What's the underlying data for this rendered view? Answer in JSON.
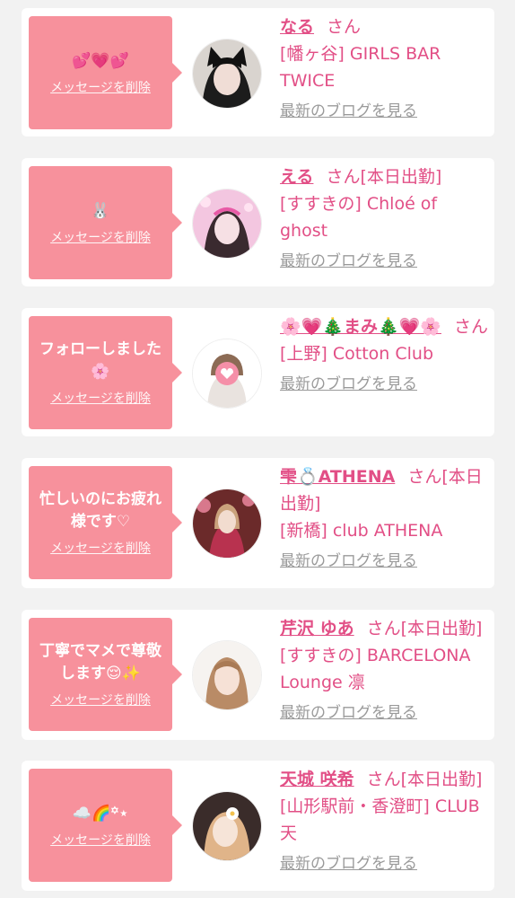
{
  "messages": [
    {
      "bubble_text": "💕💗💕",
      "delete_label": "メッセージを削除",
      "name": "なる",
      "honorific": "さん",
      "status": "",
      "shop": "[幡ヶ谷] GIRLS BAR TWICE",
      "blog_label": "最新のブログを見る",
      "avatar_icon": "cat-ears-portrait"
    },
    {
      "bubble_text": "🐰",
      "delete_label": "メッセージを削除",
      "name": "える",
      "honorific": "さん",
      "status": "[本日出勤]",
      "shop": "[すすきの] Chloé of ghost",
      "blog_label": "最新のブログを見る",
      "avatar_icon": "pink-portrait"
    },
    {
      "bubble_text": "フォローしました🌸",
      "delete_label": "メッセージを削除",
      "name": "🌸💗🎄まみ🎄💗🌸",
      "honorific": "さん",
      "status": "",
      "shop": "[上野] Cotton Club",
      "blog_label": "最新のブログを見る",
      "avatar_icon": "heart-face-portrait"
    },
    {
      "bubble_text": "忙しいのにお疲れ様です♡",
      "delete_label": "メッセージを削除",
      "name": "雫💍ATHENA",
      "honorific": "さん",
      "status": "[本日出勤]",
      "shop": "[新橋] club ATHENA",
      "blog_label": "最新のブログを見る",
      "avatar_icon": "kimono-portrait"
    },
    {
      "bubble_text": "丁寧でマメで尊敬します😌✨",
      "delete_label": "メッセージを削除",
      "name": "芹沢 ゆあ",
      "honorific": "さん",
      "status": "[本日出勤]",
      "shop": "[すすきの] BARCELONA Lounge 凛",
      "blog_label": "最新のブログを見る",
      "avatar_icon": "portrait"
    },
    {
      "bubble_text": "☁️🌈꙳⋆",
      "delete_label": "メッセージを削除",
      "name": "天城 咲希",
      "honorific": "さん",
      "status": "[本日出勤]",
      "shop": "[山形駅前・香澄町] CLUB 天",
      "blog_label": "最新のブログを見る",
      "avatar_icon": "flower-portrait"
    }
  ],
  "colors": {
    "accent": "#e24f86",
    "bubble": "#f7919c",
    "link_gray": "#9a9a9a",
    "background": "#f2f2f2"
  }
}
